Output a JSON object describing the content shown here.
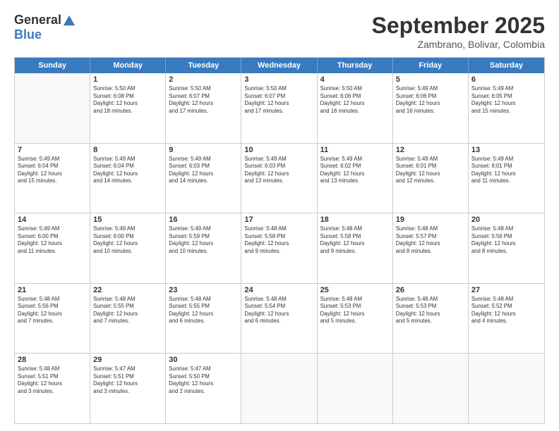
{
  "logo": {
    "general": "General",
    "blue": "Blue"
  },
  "title": "September 2025",
  "subtitle": "Zambrano, Bolivar, Colombia",
  "header_days": [
    "Sunday",
    "Monday",
    "Tuesday",
    "Wednesday",
    "Thursday",
    "Friday",
    "Saturday"
  ],
  "weeks": [
    [
      {
        "day": "",
        "info": ""
      },
      {
        "day": "1",
        "info": "Sunrise: 5:50 AM\nSunset: 6:08 PM\nDaylight: 12 hours\nand 18 minutes."
      },
      {
        "day": "2",
        "info": "Sunrise: 5:50 AM\nSunset: 6:07 PM\nDaylight: 12 hours\nand 17 minutes."
      },
      {
        "day": "3",
        "info": "Sunrise: 5:50 AM\nSunset: 6:07 PM\nDaylight: 12 hours\nand 17 minutes."
      },
      {
        "day": "4",
        "info": "Sunrise: 5:50 AM\nSunset: 6:06 PM\nDaylight: 12 hours\nand 16 minutes."
      },
      {
        "day": "5",
        "info": "Sunrise: 5:49 AM\nSunset: 6:06 PM\nDaylight: 12 hours\nand 16 minutes."
      },
      {
        "day": "6",
        "info": "Sunrise: 5:49 AM\nSunset: 6:05 PM\nDaylight: 12 hours\nand 15 minutes."
      }
    ],
    [
      {
        "day": "7",
        "info": "Sunrise: 5:49 AM\nSunset: 6:04 PM\nDaylight: 12 hours\nand 15 minutes."
      },
      {
        "day": "8",
        "info": "Sunrise: 5:49 AM\nSunset: 6:04 PM\nDaylight: 12 hours\nand 14 minutes."
      },
      {
        "day": "9",
        "info": "Sunrise: 5:49 AM\nSunset: 6:03 PM\nDaylight: 12 hours\nand 14 minutes."
      },
      {
        "day": "10",
        "info": "Sunrise: 5:49 AM\nSunset: 6:03 PM\nDaylight: 12 hours\nand 13 minutes."
      },
      {
        "day": "11",
        "info": "Sunrise: 5:49 AM\nSunset: 6:02 PM\nDaylight: 12 hours\nand 13 minutes."
      },
      {
        "day": "12",
        "info": "Sunrise: 5:49 AM\nSunset: 6:01 PM\nDaylight: 12 hours\nand 12 minutes."
      },
      {
        "day": "13",
        "info": "Sunrise: 5:49 AM\nSunset: 6:01 PM\nDaylight: 12 hours\nand 11 minutes."
      }
    ],
    [
      {
        "day": "14",
        "info": "Sunrise: 5:49 AM\nSunset: 6:00 PM\nDaylight: 12 hours\nand 11 minutes."
      },
      {
        "day": "15",
        "info": "Sunrise: 5:49 AM\nSunset: 6:00 PM\nDaylight: 12 hours\nand 10 minutes."
      },
      {
        "day": "16",
        "info": "Sunrise: 5:49 AM\nSunset: 5:59 PM\nDaylight: 12 hours\nand 10 minutes."
      },
      {
        "day": "17",
        "info": "Sunrise: 5:48 AM\nSunset: 5:58 PM\nDaylight: 12 hours\nand 9 minutes."
      },
      {
        "day": "18",
        "info": "Sunrise: 5:48 AM\nSunset: 5:58 PM\nDaylight: 12 hours\nand 9 minutes."
      },
      {
        "day": "19",
        "info": "Sunrise: 5:48 AM\nSunset: 5:57 PM\nDaylight: 12 hours\nand 8 minutes."
      },
      {
        "day": "20",
        "info": "Sunrise: 5:48 AM\nSunset: 5:56 PM\nDaylight: 12 hours\nand 8 minutes."
      }
    ],
    [
      {
        "day": "21",
        "info": "Sunrise: 5:48 AM\nSunset: 5:56 PM\nDaylight: 12 hours\nand 7 minutes."
      },
      {
        "day": "22",
        "info": "Sunrise: 5:48 AM\nSunset: 5:55 PM\nDaylight: 12 hours\nand 7 minutes."
      },
      {
        "day": "23",
        "info": "Sunrise: 5:48 AM\nSunset: 5:55 PM\nDaylight: 12 hours\nand 6 minutes."
      },
      {
        "day": "24",
        "info": "Sunrise: 5:48 AM\nSunset: 5:54 PM\nDaylight: 12 hours\nand 6 minutes."
      },
      {
        "day": "25",
        "info": "Sunrise: 5:48 AM\nSunset: 5:53 PM\nDaylight: 12 hours\nand 5 minutes."
      },
      {
        "day": "26",
        "info": "Sunrise: 5:48 AM\nSunset: 5:53 PM\nDaylight: 12 hours\nand 5 minutes."
      },
      {
        "day": "27",
        "info": "Sunrise: 5:48 AM\nSunset: 5:52 PM\nDaylight: 12 hours\nand 4 minutes."
      }
    ],
    [
      {
        "day": "28",
        "info": "Sunrise: 5:48 AM\nSunset: 5:51 PM\nDaylight: 12 hours\nand 3 minutes."
      },
      {
        "day": "29",
        "info": "Sunrise: 5:47 AM\nSunset: 5:51 PM\nDaylight: 12 hours\nand 3 minutes."
      },
      {
        "day": "30",
        "info": "Sunrise: 5:47 AM\nSunset: 5:50 PM\nDaylight: 12 hours\nand 2 minutes."
      },
      {
        "day": "",
        "info": ""
      },
      {
        "day": "",
        "info": ""
      },
      {
        "day": "",
        "info": ""
      },
      {
        "day": "",
        "info": ""
      }
    ]
  ]
}
